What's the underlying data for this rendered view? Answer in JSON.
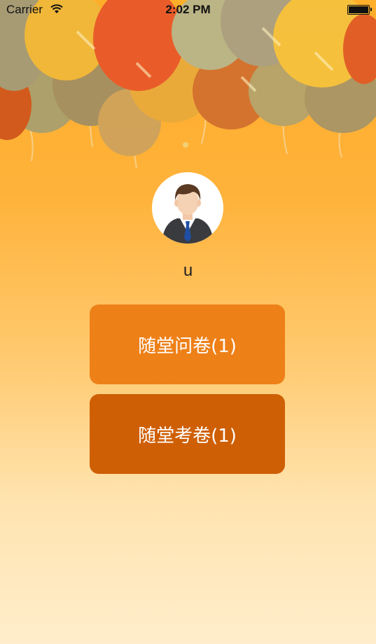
{
  "status_bar": {
    "carrier": "Carrier",
    "time": "2:02 PM"
  },
  "profile": {
    "username": "u",
    "avatar_icon": "user-avatar-businessman-icon"
  },
  "actions": {
    "survey_label": "随堂问卷(1)",
    "exam_label": "随堂考卷(1)"
  },
  "colors": {
    "survey_button": "#ee8018",
    "exam_button": "#cf5f05",
    "background_top": "#ffae2a",
    "background_bottom": "#ffedcb"
  }
}
